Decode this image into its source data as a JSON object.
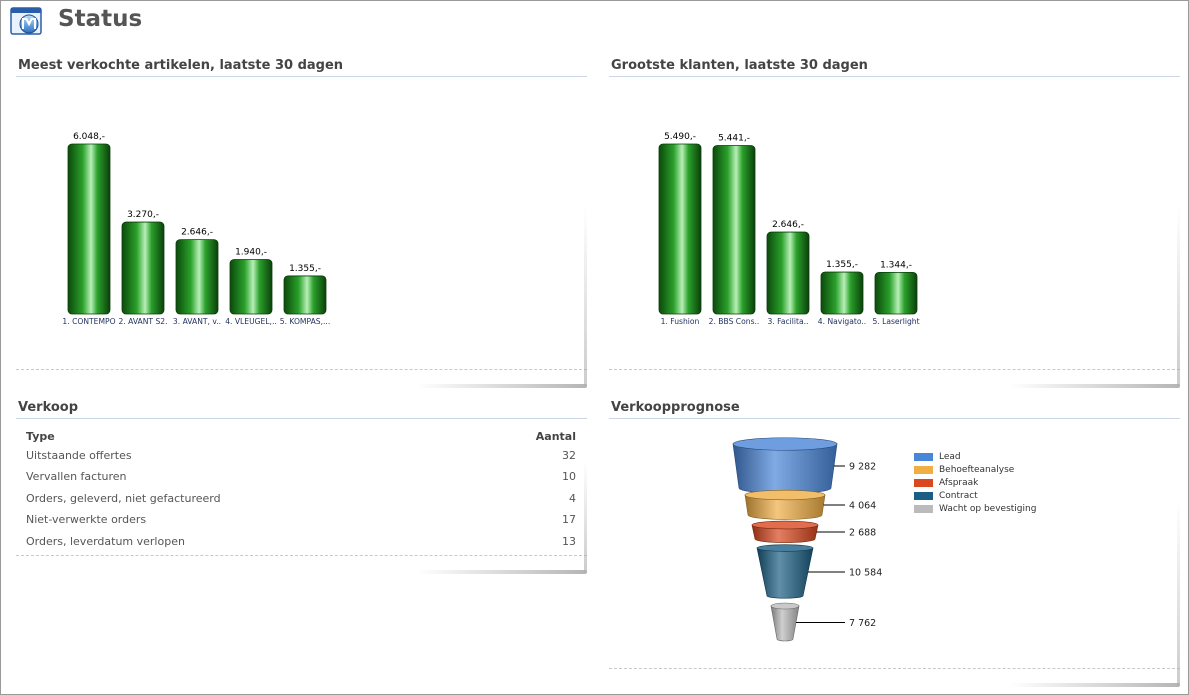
{
  "page": {
    "title": "Status"
  },
  "panels": {
    "articles": {
      "title": "Meest verkochte artikelen, laatste 30 dagen",
      "chart_data": {
        "type": "bar",
        "categories": [
          "1. CONTEMPO",
          "2. AVANT S2.",
          "3. AVANT, v..",
          "4. VLEUGEL,..",
          "5. KOMPAS,..."
        ],
        "values": [
          6048,
          3270,
          2646,
          1940,
          1355
        ],
        "data_labels": [
          "6.048,-",
          "3.270,-",
          "2.646,-",
          "1.940,-",
          "1.355,-"
        ],
        "ylim": [
          0,
          6048
        ],
        "color": "#1e8a1e",
        "grid": false
      }
    },
    "customers": {
      "title": "Grootste klanten, laatste 30 dagen",
      "chart_data": {
        "type": "bar",
        "categories": [
          "1. Fushion",
          "2. BBS Cons..",
          "3. Facilita..",
          "4. Navigato..",
          "5. Laserlight"
        ],
        "values": [
          5490,
          5441,
          2646,
          1355,
          1344
        ],
        "data_labels": [
          "5.490,-",
          "5.441,-",
          "2.646,-",
          "1.355,-",
          "1.344,-"
        ],
        "ylim": [
          0,
          5490
        ],
        "color": "#1e8a1e",
        "grid": false
      }
    },
    "sales": {
      "title": "Verkoop",
      "headers": {
        "type": "Type",
        "count": "Aantal"
      },
      "rows": [
        {
          "type": "Uitstaande offertes",
          "count": "32"
        },
        {
          "type": "Vervallen facturen",
          "count": "10"
        },
        {
          "type": "Orders, geleverd, niet gefactureerd",
          "count": "4"
        },
        {
          "type": "Niet-verwerkte orders",
          "count": "17"
        },
        {
          "type": "Orders, leverdatum verlopen",
          "count": "13"
        }
      ]
    },
    "forecast": {
      "title": "Verkoopprognose",
      "chart_data": {
        "type": "funnel",
        "stages": [
          {
            "name": "Lead",
            "value": 9282,
            "label": "9 282",
            "color": "#4a86d8"
          },
          {
            "name": "Behoefteanalyse",
            "value": 4064,
            "label": "4 064",
            "color": "#f0ae45"
          },
          {
            "name": "Afspraak",
            "value": 2688,
            "label": "2 688",
            "color": "#d9481f"
          },
          {
            "name": "Contract",
            "value": 10584,
            "label": "10 584",
            "color": "#1c5f84"
          },
          {
            "name": "Wacht op bevestiging",
            "value": 7762,
            "label": "7 762",
            "color": "#bbbbbb"
          }
        ],
        "legend_position": "right"
      }
    }
  }
}
